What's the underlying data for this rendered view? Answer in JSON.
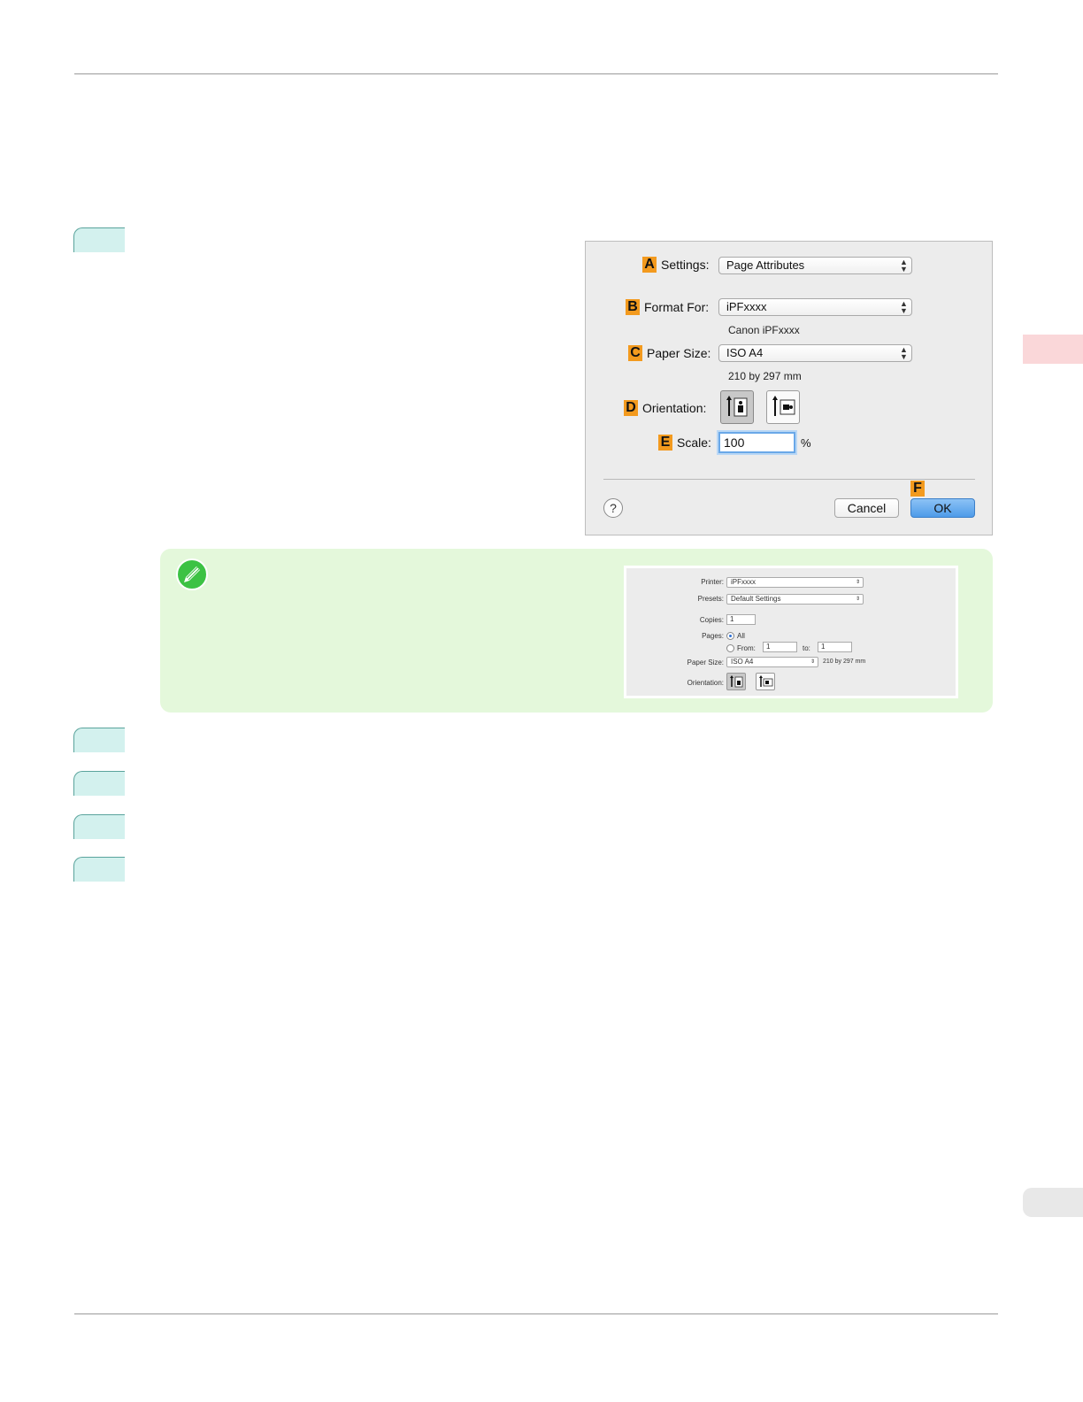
{
  "dialog": {
    "settings": {
      "badge": "A",
      "label": "Settings:",
      "value": "Page Attributes"
    },
    "format_for": {
      "badge": "B",
      "label": "Format For:",
      "value": "iPFxxxx",
      "sub": "Canon iPFxxxx"
    },
    "paper_size": {
      "badge": "C",
      "label": "Paper Size:",
      "value": "ISO A4",
      "sub": "210 by 297 mm"
    },
    "orientation": {
      "badge": "D",
      "label": "Orientation:"
    },
    "scale": {
      "badge": "E",
      "label": "Scale:",
      "value": "100",
      "unit": "%"
    },
    "help": "?",
    "cancel": "Cancel",
    "ok_badge": "F",
    "ok": "OK"
  },
  "mini_dialog": {
    "printer_label": "Printer:",
    "printer_value": "iPFxxxx",
    "presets_label": "Presets:",
    "presets_value": "Default Settings",
    "copies_label": "Copies:",
    "copies_value": "1",
    "pages_label": "Pages:",
    "pages_all": "All",
    "pages_from": "From:",
    "pages_from_value": "1",
    "pages_to": "to:",
    "pages_to_value": "1",
    "paper_size_label": "Paper Size:",
    "paper_size_value": "ISO A4",
    "paper_size_dims": "210 by 297 mm",
    "orientation_label": "Orientation:"
  },
  "colors": {
    "badge": "#f39a1e",
    "step_tab": "#d3f1ee",
    "note_bg": "#e4f8db",
    "side_tab_pink": "#fad7d9",
    "ok_button": "#4e9be9"
  },
  "icons": [
    "note-pencil-icon",
    "portrait-orientation-icon",
    "landscape-orientation-icon",
    "popup-arrows-icon",
    "help-icon"
  ]
}
